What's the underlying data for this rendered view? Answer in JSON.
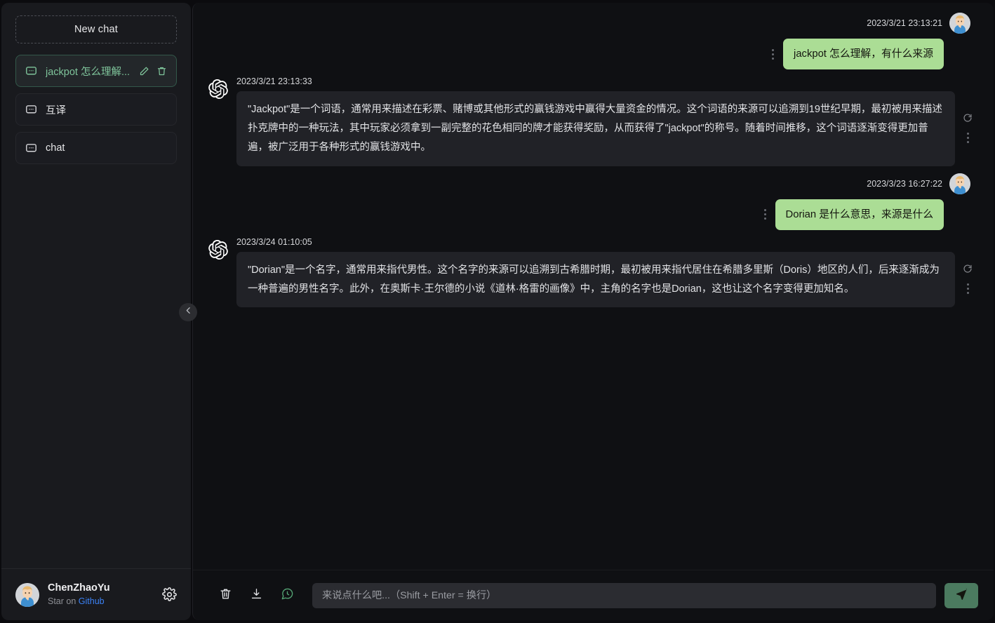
{
  "sidebar": {
    "new_chat_label": "New chat",
    "chats": [
      {
        "label": "jackpot 怎么理解...",
        "icon": "chat-bubble-icon",
        "active": true
      },
      {
        "label": "互译",
        "icon": "chat-bubble-icon",
        "active": false
      },
      {
        "label": "chat",
        "icon": "chat-bubble-icon",
        "active": false
      }
    ],
    "item_actions": {
      "edit": "pencil-icon",
      "delete": "trash-icon"
    },
    "user": {
      "name": "ChenZhaoYu",
      "sub_prefix": "Star on ",
      "sub_link": "Github",
      "settings_icon": "gear-icon"
    },
    "collapse_icon": "chevron-left-icon"
  },
  "conversation": {
    "messages": [
      {
        "role": "user",
        "timestamp": "2023/3/21 23:13:21",
        "text": "jackpot 怎么理解，有什么来源"
      },
      {
        "role": "assistant",
        "timestamp": "2023/3/21 23:13:33",
        "text": "\"Jackpot\"是一个词语，通常用来描述在彩票、赌博或其他形式的赢钱游戏中赢得大量资金的情况。这个词语的来源可以追溯到19世纪早期，最初被用来描述扑克牌中的一种玩法，其中玩家必须拿到一副完整的花色相同的牌才能获得奖励，从而获得了\"jackpot\"的称号。随着时间推移，这个词语逐渐变得更加普遍，被广泛用于各种形式的赢钱游戏中。"
      },
      {
        "role": "user",
        "timestamp": "2023/3/23 16:27:22",
        "text": "Dorian 是什么意思，来源是什么"
      },
      {
        "role": "assistant",
        "timestamp": "2023/3/24 01:10:05",
        "text": "\"Dorian\"是一个名字，通常用来指代男性。这个名字的来源可以追溯到古希腊时期，最初被用来指代居住在希腊多里斯（Doris）地区的人们，后来逐渐成为一种普遍的男性名字。此外，在奥斯卡·王尔德的小说《道林·格雷的画像》中，主角的名字也是Dorian，这也让这个名字变得更加知名。"
      }
    ],
    "message_actions": {
      "more": "more-vertical-icon",
      "regenerate": "refresh-icon"
    }
  },
  "composer": {
    "tools": [
      {
        "name": "clear-conversation-button",
        "icon": "trash-icon"
      },
      {
        "name": "export-conversation-button",
        "icon": "download-icon"
      },
      {
        "name": "chat-history-button",
        "icon": "chat-clock-icon"
      }
    ],
    "input_placeholder": "来说点什么吧...（Shift + Enter = 换行）",
    "input_value": "",
    "send_icon": "send-plane-icon"
  },
  "colors": {
    "accent_green": "#abdd95",
    "active_green": "#7fc49b",
    "link_blue": "#3b82f6",
    "sidebar_bg": "#191a1e",
    "main_bg": "#0f1013",
    "bubble_bot_bg": "#212227"
  }
}
